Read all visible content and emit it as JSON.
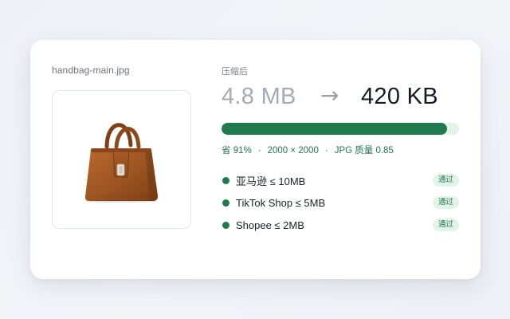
{
  "file": {
    "name": "handbag-main.jpg",
    "image_icon": "handbag-photo"
  },
  "compression": {
    "label": "压缩后",
    "before": "4.8 MB",
    "arrow": "→",
    "after": "420 KB",
    "progress_fraction": 0.95,
    "saving": "省 91%",
    "dimensions": "2000 × 2000",
    "format": "JPG 质量 0.85",
    "separator": "·"
  },
  "checks": [
    {
      "label": "亚马逊 ≤ 10MB",
      "status": "通过"
    },
    {
      "label": "TikTok Shop ≤ 5MB",
      "status": "通过"
    },
    {
      "label": "Shopee ≤ 2MB",
      "status": "通过"
    }
  ],
  "colors": {
    "accent": "#1f7a4d",
    "accent_light": "#e3f3e9",
    "muted": "#a5abb5",
    "text": "#161a22"
  }
}
